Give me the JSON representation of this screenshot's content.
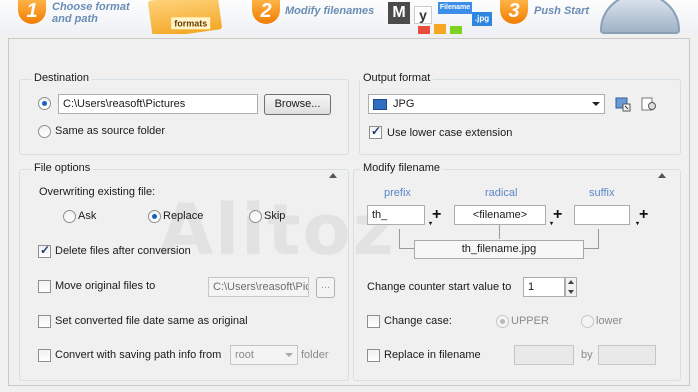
{
  "banner": {
    "steps": [
      {
        "number": "1",
        "line1": "Choose format",
        "line2": "and path"
      },
      {
        "number": "2",
        "line1": "Modify filenames"
      },
      {
        "number": "3",
        "line1": "Push Start"
      }
    ],
    "folder_label": "formats",
    "tiles": [
      "M",
      "y",
      "Filename",
      ".jpg"
    ]
  },
  "destination": {
    "title": "Destination",
    "path_value": "C:\\Users\\reasoft\\Pictures",
    "browse_label": "Browse...",
    "same_as_source_label": "Same as source folder"
  },
  "output_format": {
    "title": "Output format",
    "selected_format": "JPG",
    "lower_case_label": "Use lower case extension"
  },
  "file_options": {
    "title": "File options",
    "overwriting_label": "Overwriting existing file:",
    "ask_label": "Ask",
    "replace_label": "Replace",
    "skip_label": "Skip",
    "delete_label": "Delete files after conversion",
    "move_label": "Move original files to",
    "move_path": "C:\\Users\\reasoft\\Pic",
    "browse_small_label": "...",
    "set_date_label": "Set converted file date same as original",
    "convert_path_label": "Convert with saving path info from",
    "root_option": "root",
    "folder_label": "folder"
  },
  "modify_filename": {
    "title": "Modify filename",
    "prefix_label": "prefix",
    "radical_label": "radical",
    "suffix_label": "suffix",
    "prefix_value": "th_",
    "radical_value": "<filename>",
    "suffix_value": "",
    "preview": "th_filename.jpg",
    "counter_label": "Change counter start value to",
    "counter_value": "1",
    "change_case_label": "Change case:",
    "upper_label": "UPPER",
    "lower_label": "lower",
    "replace_label": "Replace in filename",
    "by_label": "by"
  },
  "watermark": "Alitoz"
}
